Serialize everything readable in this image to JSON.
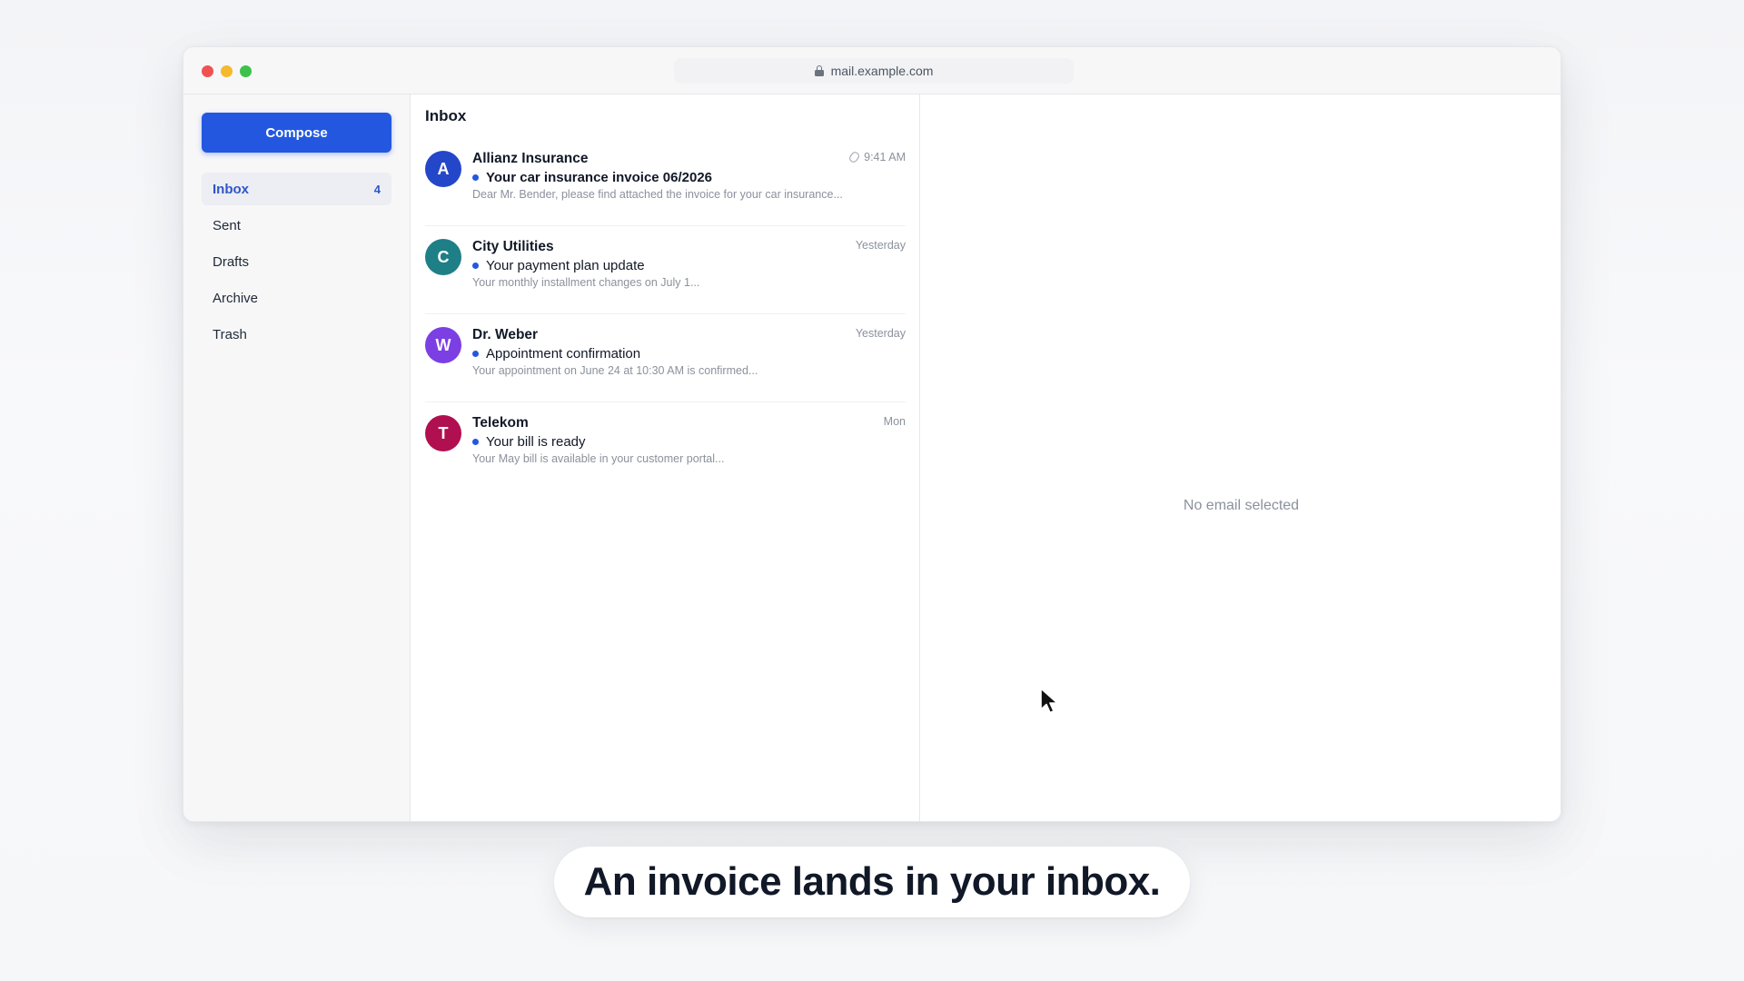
{
  "browser": {
    "url": "mail.example.com"
  },
  "sidebar": {
    "compose_label": "Compose",
    "items": [
      {
        "label": "Inbox",
        "count": "4",
        "active": true
      },
      {
        "label": "Sent",
        "count": ""
      },
      {
        "label": "Drafts",
        "count": ""
      },
      {
        "label": "Archive",
        "count": ""
      },
      {
        "label": "Trash",
        "count": ""
      }
    ]
  },
  "inbox": {
    "title": "Inbox",
    "emails": [
      {
        "avatar": "A",
        "avatar_color": "#2447c9",
        "sender": "Allianz Insurance",
        "subject": "Your car insurance invoice 06/2026",
        "preview": "Dear Mr. Bender, please find attached the invoice for your car insurance...",
        "time": "9:41 AM",
        "attachment": true,
        "unread": true
      },
      {
        "avatar": "C",
        "avatar_color": "#1f7f86",
        "sender": "City Utilities",
        "subject": "Your payment plan update",
        "preview": "Your monthly installment changes on July 1...",
        "time": "Yesterday",
        "attachment": false,
        "unread": true
      },
      {
        "avatar": "W",
        "avatar_color": "#7b3fe4",
        "sender": "Dr. Weber",
        "subject": "Appointment confirmation",
        "preview": "Your appointment on June 24 at 10:30 AM is confirmed...",
        "time": "Yesterday",
        "attachment": false,
        "unread": true
      },
      {
        "avatar": "T",
        "avatar_color": "#b0104f",
        "sender": "Telekom",
        "subject": "Your bill is ready",
        "preview": "Your May bill is available in your customer portal...",
        "time": "Mon",
        "attachment": false,
        "unread": true
      }
    ]
  },
  "reading_pane": {
    "empty_text": "No email selected"
  },
  "caption": {
    "text": "An invoice lands in your inbox."
  },
  "colors": {
    "accent": "#2357e0",
    "active_nav_text": "#2f55c9"
  }
}
